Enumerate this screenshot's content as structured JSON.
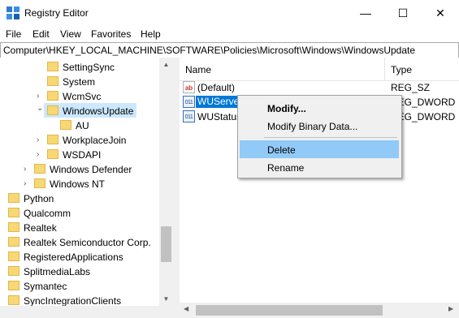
{
  "window": {
    "title": "Registry Editor",
    "minimize": "—",
    "maximize": "☐",
    "close": "✕"
  },
  "menu": [
    "File",
    "Edit",
    "View",
    "Favorites",
    "Help"
  ],
  "address": "Computer\\HKEY_LOCAL_MACHINE\\SOFTWARE\\Policies\\Microsoft\\Windows\\WindowsUpdate",
  "tree": [
    {
      "label": "SettingSync",
      "expander": ""
    },
    {
      "label": "System",
      "expander": ""
    },
    {
      "label": "WcmSvc",
      "expander": "›"
    },
    {
      "label": "WindowsUpdate",
      "expander": "⌄",
      "selected": true
    },
    {
      "label": "AU",
      "expander": ""
    },
    {
      "label": "WorkplaceJoin",
      "expander": "›"
    },
    {
      "label": "WSDAPI",
      "expander": "›"
    },
    {
      "label": "Windows Defender",
      "expander": "›"
    },
    {
      "label": "Windows NT",
      "expander": "›"
    },
    {
      "label": "Python",
      "expander": ""
    },
    {
      "label": "Qualcomm",
      "expander": ""
    },
    {
      "label": "Realtek",
      "expander": ""
    },
    {
      "label": "Realtek Semiconductor Corp.",
      "expander": ""
    },
    {
      "label": "RegisteredApplications",
      "expander": ""
    },
    {
      "label": "SplitmediaLabs",
      "expander": ""
    },
    {
      "label": "Symantec",
      "expander": ""
    },
    {
      "label": "SyncIntegrationClients",
      "expander": ""
    }
  ],
  "list": {
    "headers": {
      "name": "Name",
      "type": "Type"
    },
    "rows": [
      {
        "icon": "ab",
        "name": "(Default)",
        "type": "REG_SZ"
      },
      {
        "icon": "011",
        "name": "WUServer",
        "type": "REG_DWORD"
      },
      {
        "icon": "011",
        "name": "WUStatusServer",
        "type": "REG_DWORD"
      }
    ]
  },
  "context_menu": {
    "modify": "Modify...",
    "modify_binary": "Modify Binary Data...",
    "delete": "Delete",
    "rename": "Rename"
  },
  "colors": {
    "selection": "#0078d7",
    "folder": "#f8d775",
    "tree_selected": "#cce8ff",
    "menu_hover": "#91c9f7"
  }
}
